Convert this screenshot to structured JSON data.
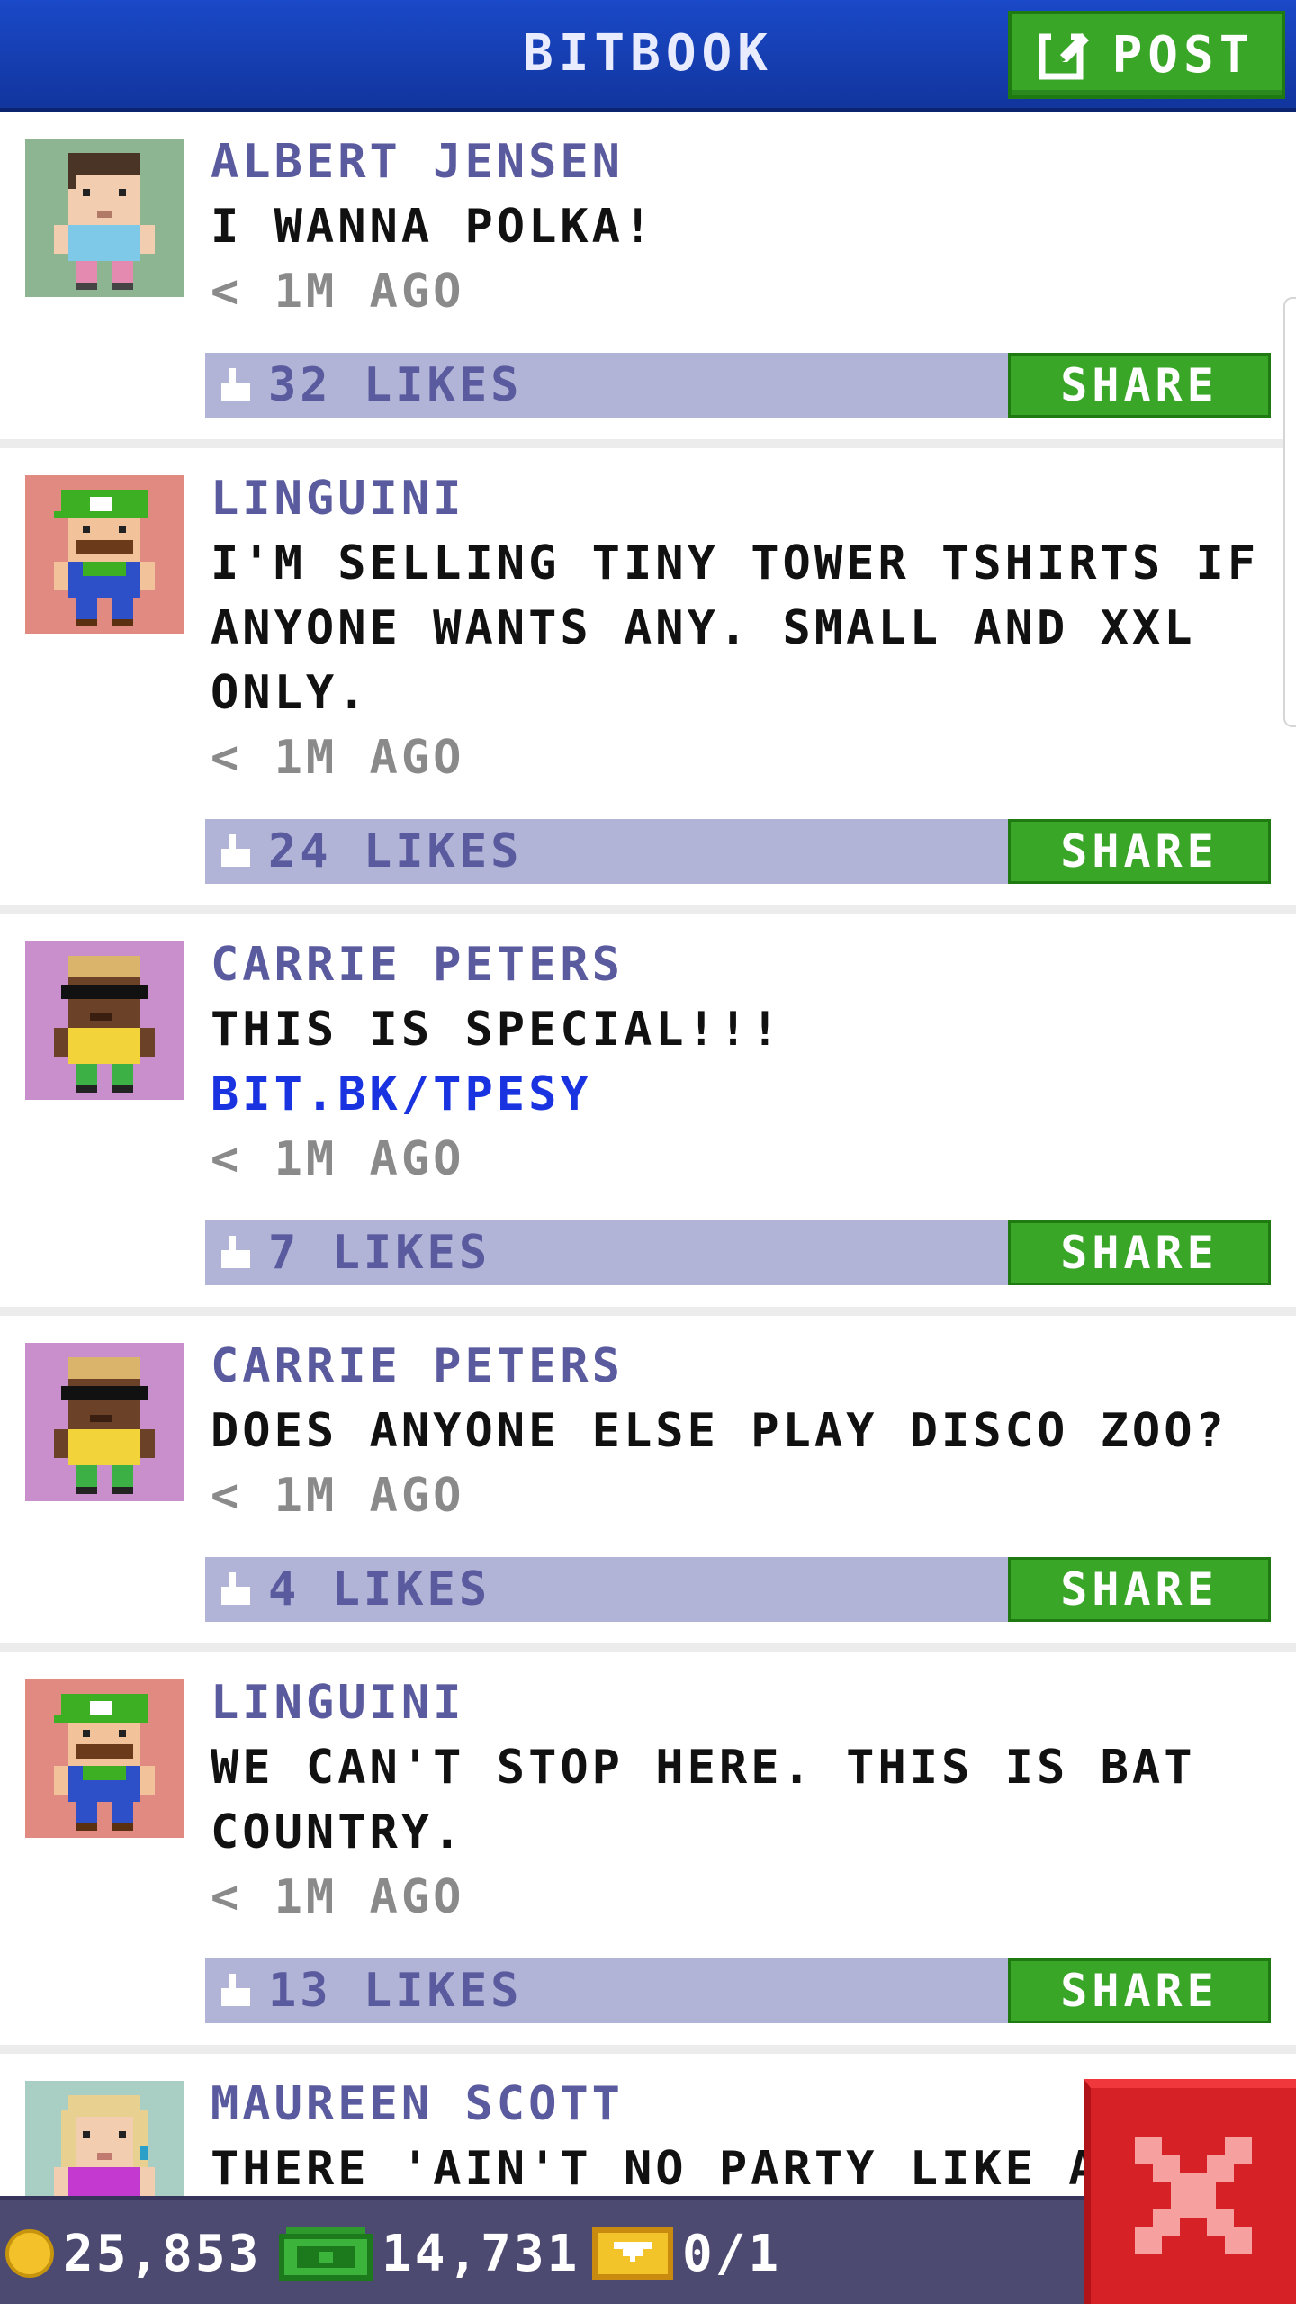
{
  "header": {
    "title": "BITBOOK",
    "post_label": "POST"
  },
  "feed": {
    "posts": [
      {
        "author": "ALBERT JENSEN",
        "text": "I WANNA POLKA!",
        "link": "",
        "time": "< 1M AGO",
        "likes": "32 LIKES",
        "share_label": "SHARE",
        "avatar": "albert-jensen-avatar"
      },
      {
        "author": "LINGUINI",
        "text": "I'M SELLING TINY TOWER TSHIRTS IF ANYONE WANTS ANY. SMALL AND XXL ONLY.",
        "link": "",
        "time": "< 1M AGO",
        "likes": "24 LIKES",
        "share_label": "SHARE",
        "avatar": "linguini-avatar"
      },
      {
        "author": "CARRIE PETERS",
        "text": "THIS IS SPECIAL!!!",
        "link": "BIT.BK/TPESY",
        "time": "< 1M AGO",
        "likes": "7 LIKES",
        "share_label": "SHARE",
        "avatar": "carrie-peters-avatar"
      },
      {
        "author": "CARRIE PETERS",
        "text": "DOES ANYONE ELSE PLAY DISCO ZOO?",
        "link": "",
        "time": "< 1M AGO",
        "likes": "4 LIKES",
        "share_label": "SHARE",
        "avatar": "carrie-peters-avatar"
      },
      {
        "author": "LINGUINI",
        "text": "WE CAN'T STOP HERE. THIS IS BAT COUNTRY.",
        "link": "",
        "time": "< 1M AGO",
        "likes": "13 LIKES",
        "share_label": "SHARE",
        "avatar": "linguini-avatar"
      },
      {
        "author": "MAUREEN SCOTT",
        "text": "THERE 'AIN'T NO PARTY LIKE A T",
        "link": "",
        "time": "",
        "likes": "",
        "share_label": "",
        "avatar": "maureen-scott-avatar"
      }
    ]
  },
  "status_bar": {
    "coins": "25,853",
    "bux": "14,731",
    "tickets": "0/1"
  },
  "colors": {
    "header_blue": "#1a49c8",
    "button_green": "#3aa628",
    "likes_bar": "#b1b4d6",
    "author_purple": "#5a5a9e",
    "link_blue": "#1a33e0",
    "status_bar": "#4d4a72",
    "close_red": "#d62226"
  }
}
